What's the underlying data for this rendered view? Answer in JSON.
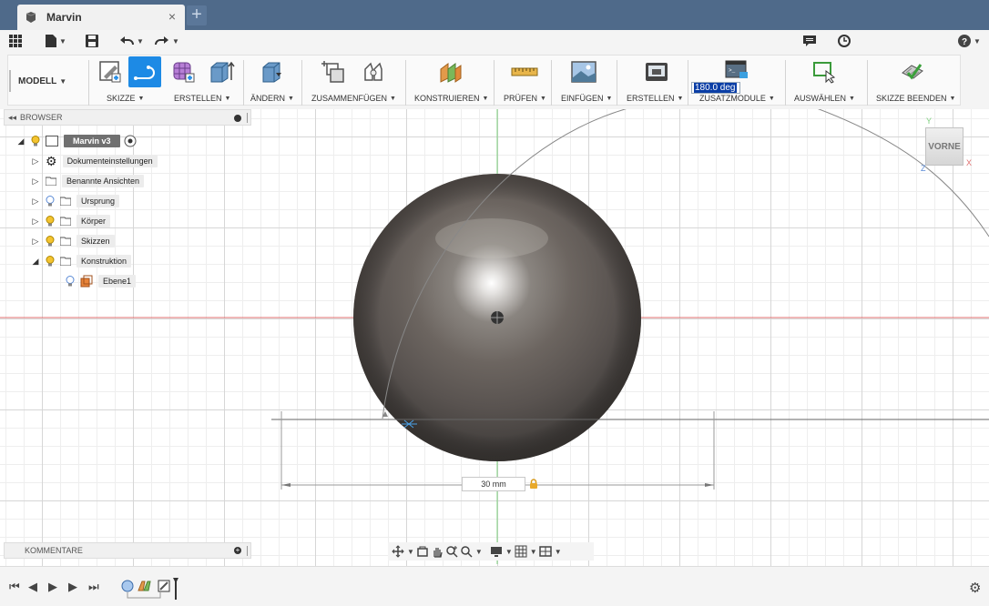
{
  "app": {
    "tab_title": "Marvin",
    "tab_close": "×",
    "new_tab": "+"
  },
  "toolbar": {
    "mode_label": "MODELL",
    "groups": [
      {
        "id": "skizze",
        "label": "SKIZZE"
      },
      {
        "id": "erstellen",
        "label": "ERSTELLEN"
      },
      {
        "id": "aendern",
        "label": "ÄNDERN"
      },
      {
        "id": "zusammenfuegen",
        "label": "ZUSAMMENFÜGEN"
      },
      {
        "id": "konstruieren",
        "label": "KONSTRUIEREN"
      },
      {
        "id": "pruefen",
        "label": "PRÜFEN"
      },
      {
        "id": "einfuegen",
        "label": "EINFÜGEN"
      },
      {
        "id": "erstellen2",
        "label": "ERSTELLEN"
      },
      {
        "id": "zusatzmodule",
        "label": "ZUSATZMODULE"
      },
      {
        "id": "auswaehlen",
        "label": "AUSWÄHLEN"
      },
      {
        "id": "skizze_beenden",
        "label": "SKIZZE BEENDEN"
      }
    ]
  },
  "angle_input": {
    "value": "180.0 deg"
  },
  "browser": {
    "title": "BROWSER",
    "root": "Marvin v3",
    "items": [
      {
        "label": "Dokumenteinstellungen"
      },
      {
        "label": "Benannte Ansichten"
      },
      {
        "label": "Ursprung"
      },
      {
        "label": "Körper"
      },
      {
        "label": "Skizzen"
      },
      {
        "label": "Konstruktion"
      },
      {
        "label": "Ebene1"
      }
    ]
  },
  "comments": {
    "title": "KOMMENTARE"
  },
  "viewcube": {
    "face_label": "VORNE",
    "axis_y": "Y",
    "axis_x": "X",
    "axis_z": "Z"
  },
  "dimension": {
    "value": "30 mm"
  },
  "colors": {
    "titlebar": "#4f6a8a",
    "accent": "#1d8ae5",
    "x_axis": "#e07070",
    "y_axis": "#7ed07e"
  }
}
